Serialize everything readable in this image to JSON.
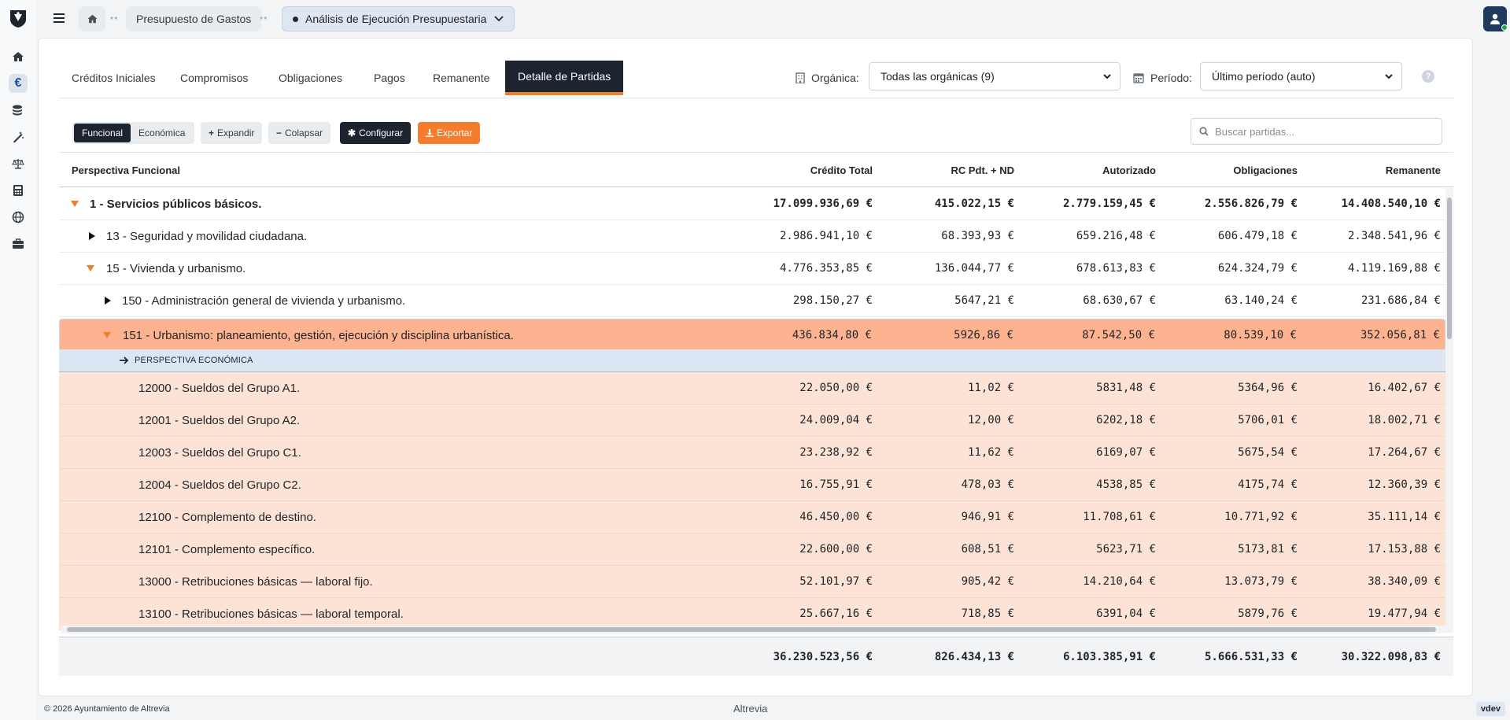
{
  "topbar": {
    "breadcrumb_1": "Presupuesto de Gastos",
    "breadcrumb_2": "Análisis de Ejecución Presupuestaria"
  },
  "tabs": [
    "Créditos Iniciales",
    "Compromisos",
    "Obligaciones",
    "Pagos",
    "Remanente",
    "Detalle de Partidas"
  ],
  "filters": {
    "organica_label": "Orgánica:",
    "organica_value": "Todas las orgánicas (9)",
    "periodo_label": "Período:",
    "periodo_value": "Último período (auto)",
    "help": "?"
  },
  "toolbar": {
    "perspectives": [
      "Funcional",
      "Económica"
    ],
    "expand": "Expandir",
    "collapse": "Colapsar",
    "configure": "Configurar",
    "export": "Exportar",
    "search_placeholder": "Buscar partidas..."
  },
  "table": {
    "columns": [
      "Perspectiva Funcional",
      "Crédito Total",
      "RC Pdt. + ND",
      "Autorizado",
      "Obligaciones",
      "Remanente"
    ],
    "rows": [
      {
        "label": "1 - Servicios públicos básicos.",
        "values": [
          "17.099.936,69 €",
          "415.022,15 €",
          "2.779.159,45 €",
          "2.556.826,79 €",
          "14.408.540,10 €"
        ]
      },
      {
        "label": "13 - Seguridad y movilidad ciudadana.",
        "values": [
          "2.986.941,10 €",
          "68.393,93 €",
          "659.216,48 €",
          "606.479,18 €",
          "2.348.541,96 €"
        ]
      },
      {
        "label": "15 - Vivienda y urbanismo.",
        "values": [
          "4.776.353,85 €",
          "136.044,77 €",
          "678.613,83 €",
          "624.324,79 €",
          "4.119.169,88 €"
        ]
      },
      {
        "label": "150 - Administración general de vivienda y urbanismo.",
        "values": [
          "298.150,27 €",
          "5647,21 €",
          "68.630,67 €",
          "63.140,24 €",
          "231.686,84 €"
        ]
      },
      {
        "label": "151 - Urbanismo: planeamiento, gestión, ejecución y disciplina urbanística.",
        "values": [
          "436.834,80 €",
          "5926,86 €",
          "87.542,50 €",
          "80.539,10 €",
          "352.056,81 €"
        ]
      }
    ],
    "perspective_label": "PERSPECTIVA ECONÓMICA",
    "sub_rows": [
      {
        "label": "12000 - Sueldos del Grupo A1.",
        "values": [
          "22.050,00 €",
          "11,02 €",
          "5831,48 €",
          "5364,96 €",
          "16.402,67 €"
        ]
      },
      {
        "label": "12001 - Sueldos del Grupo A2.",
        "values": [
          "24.009,04 €",
          "12,00 €",
          "6202,18 €",
          "5706,01 €",
          "18.002,71 €"
        ]
      },
      {
        "label": "12003 - Sueldos del Grupo C1.",
        "values": [
          "23.238,92 €",
          "11,62 €",
          "6169,07 €",
          "5675,54 €",
          "17.264,67 €"
        ]
      },
      {
        "label": "12004 - Sueldos del Grupo C2.",
        "values": [
          "16.755,91 €",
          "478,03 €",
          "4538,85 €",
          "4175,74 €",
          "12.360,39 €"
        ]
      },
      {
        "label": "12100 - Complemento de destino.",
        "values": [
          "46.450,00 €",
          "946,91 €",
          "11.708,61 €",
          "10.771,92 €",
          "35.111,14 €"
        ]
      },
      {
        "label": "12101 - Complemento específico.",
        "values": [
          "22.600,00 €",
          "608,51 €",
          "5623,71 €",
          "5173,81 €",
          "17.153,88 €"
        ]
      },
      {
        "label": "13000 - Retribuciones básicas — laboral fijo.",
        "values": [
          "52.101,97 €",
          "905,42 €",
          "14.210,64 €",
          "13.073,79 €",
          "38.340,09 €"
        ]
      },
      {
        "label": "13100 - Retribuciones básicas — laboral temporal.",
        "values": [
          "25.667,16 €",
          "718,85 €",
          "6391,04 €",
          "5879,76 €",
          "19.477,94 €"
        ]
      }
    ],
    "totals": [
      "36.230.523,56 €",
      "826.434,13 €",
      "6.103.385,91 €",
      "5.666.531,33 €",
      "30.322.098,83 €"
    ]
  },
  "footer": {
    "copyright": "© 2026 Ayuntamiento de Altrevia",
    "brand": "Altrevia",
    "version": "vdev"
  },
  "colors": {
    "accent": "#f07c2c",
    "dark": "#1c2430",
    "selected_row": "#fdb38f",
    "sub_row": "#fde3d6",
    "perspective_row": "#dbe6f2"
  }
}
